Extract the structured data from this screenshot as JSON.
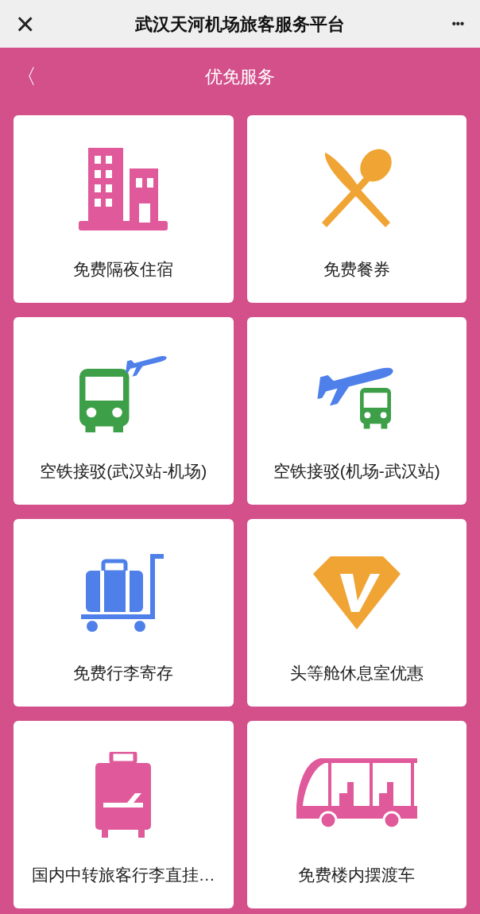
{
  "top_bar": {
    "close": "×",
    "title": "武汉天河机场旅客服务平台",
    "more": "•••"
  },
  "header": {
    "back": "〈",
    "title": "优免服务"
  },
  "services": [
    {
      "label": "免费隔夜住宿",
      "kind": "hotel"
    },
    {
      "label": "免费餐券",
      "kind": "meal"
    },
    {
      "label": "空铁接驳(武汉站-机场)",
      "kind": "bus-plane"
    },
    {
      "label": "空铁接驳(机场-武汉站)",
      "kind": "plane-bus"
    },
    {
      "label": "免费行李寄存",
      "kind": "luggage-cart"
    },
    {
      "label": "头等舱休息室优惠",
      "kind": "lounge"
    },
    {
      "label": "国内中转旅客行李直挂…",
      "kind": "suitcase"
    },
    {
      "label": "免费楼内摆渡车",
      "kind": "shuttle"
    }
  ]
}
